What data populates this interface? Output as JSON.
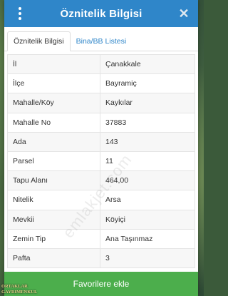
{
  "header": {
    "title": "Öznitelik Bilgisi"
  },
  "tabs": [
    {
      "label": "Öznitelik Bilgisi",
      "active": true
    },
    {
      "label": "Bina/BB Listesi",
      "active": false
    }
  ],
  "attributes": [
    {
      "key": "İl",
      "value": "Çanakkale"
    },
    {
      "key": "İlçe",
      "value": "Bayramiç"
    },
    {
      "key": "Mahalle/Köy",
      "value": "Kaykılar"
    },
    {
      "key": "Mahalle No",
      "value": "37883"
    },
    {
      "key": "Ada",
      "value": "143"
    },
    {
      "key": "Parsel",
      "value": "11"
    },
    {
      "key": "Tapu Alanı",
      "value": "464,00"
    },
    {
      "key": "Nitelik",
      "value": "Arsa"
    },
    {
      "key": "Mevkii",
      "value": "Köyiçi"
    },
    {
      "key": "Zemin Tip",
      "value": "Ana Taşınmaz"
    },
    {
      "key": "Pafta",
      "value": "3"
    }
  ],
  "watermark": "emlakjet.com",
  "footer": {
    "button_label": "Favorilere ekle"
  },
  "logo": {
    "line1": "ORTAKLAR",
    "line2": "GAYRIMENKUL"
  },
  "colors": {
    "header": "#2f86c9",
    "button": "#4cae4c",
    "tab_link": "#2f86c9"
  },
  "icons": {
    "menu": "kebab-menu-icon",
    "close": "close-icon"
  }
}
